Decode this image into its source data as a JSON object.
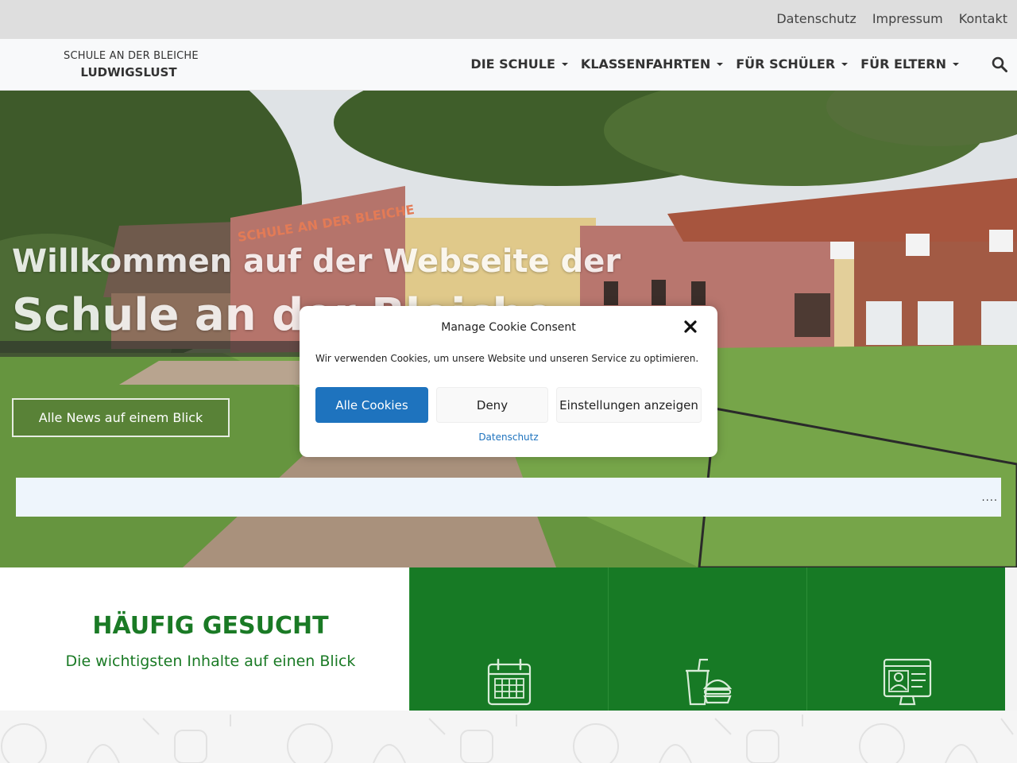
{
  "topbar": {
    "links": [
      "Datenschutz",
      "Impressum",
      "Kontakt"
    ]
  },
  "logo": {
    "line1": "SCHULE AN DER BLEICHE",
    "line2": "LUDWIGSLUST"
  },
  "nav": {
    "items": [
      "DIE SCHULE",
      "KLASSENFAHRTEN",
      "FÜR SCHÜLER",
      "FÜR ELTERN"
    ],
    "search_icon": "search-icon"
  },
  "hero": {
    "title_line1": "Willkommen auf der Webseite der",
    "title_line2": "Schule an der Bleiche",
    "button": "Alle News auf einem Blick",
    "building_sign": "SCHULE AN DER BLEICHE",
    "ticker_more": "...."
  },
  "cookie": {
    "title": "Manage Cookie Consent",
    "text": "Wir verwenden Cookies, um unsere Website und unseren Service zu optimieren.",
    "accept": "Alle Cookies",
    "deny": "Deny",
    "preferences": "Einstellungen anzeigen",
    "link": "Datenschutz"
  },
  "section": {
    "heading": "HÄUFIG GESUCHT",
    "subheading": "Die wichtigsten Inhalte auf einen Blick",
    "tiles": [
      {
        "icon": "calendar-icon"
      },
      {
        "icon": "food-menu-icon"
      },
      {
        "icon": "computer-profile-icon"
      }
    ]
  },
  "colors": {
    "brand_green": "#177a25",
    "accent_blue": "#1e73be"
  }
}
